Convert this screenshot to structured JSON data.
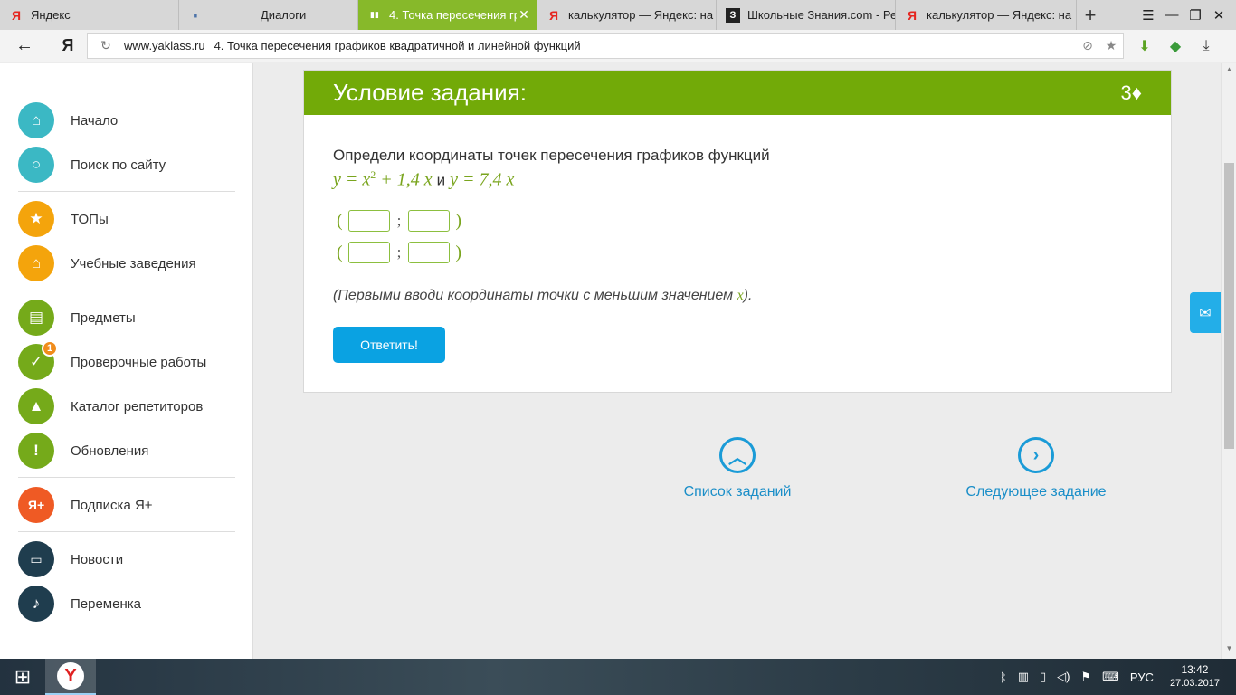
{
  "tabs": [
    {
      "icon": "Я",
      "icon_color": "#e52620",
      "title": "Яндекс",
      "active": false
    },
    {
      "icon": "▪",
      "icon_color": "#4b72a8",
      "title": "Диалоги",
      "active": false
    },
    {
      "icon": "▮▮",
      "icon_color": "#ffffff",
      "title": "4. Точка пересечения гр",
      "active": true
    },
    {
      "icon": "Я",
      "icon_color": "#e52620",
      "title": "калькулятор — Яндекс: на",
      "active": false
    },
    {
      "icon": "З",
      "icon_color": "#222222",
      "title": "Школьные Знания.com - Ре",
      "active": false
    },
    {
      "icon": "Я",
      "icon_color": "#e52620",
      "title": "калькулятор — Яндекс: на",
      "active": false
    }
  ],
  "address": {
    "domain": "www.yaklass.ru",
    "page_title": "4. Точка пересечения графиков квадратичной и линейной функций",
    "logo": "Я"
  },
  "sidebar": {
    "items": [
      {
        "label": "Начало",
        "icon": "home-icon",
        "glyph": "⌂",
        "color": "#3bb8c4"
      },
      {
        "label": "Поиск по сайту",
        "icon": "search-icon",
        "glyph": "○",
        "color": "#3bb8c4"
      },
      {
        "label": "ТОПы",
        "icon": "star-icon",
        "glyph": "★",
        "color": "#f4a40c"
      },
      {
        "label": "Учебные заведения",
        "icon": "institution-icon",
        "glyph": "⌂",
        "color": "#f4a40c"
      },
      {
        "label": "Предметы",
        "icon": "book-icon",
        "glyph": "▤",
        "color": "#75aa1a"
      },
      {
        "label": "Проверочные работы",
        "icon": "check-icon",
        "glyph": "✓",
        "color": "#75aa1a",
        "badge": "1"
      },
      {
        "label": "Каталог репетиторов",
        "icon": "graduation-cap-icon",
        "glyph": "▲",
        "color": "#75aa1a"
      },
      {
        "label": "Обновления",
        "icon": "exclamation-icon",
        "glyph": "!",
        "color": "#75aa1a"
      },
      {
        "label": "Подписка Я+",
        "icon": "ya-plus-icon",
        "glyph": "Я+",
        "color": "#ef5a24"
      },
      {
        "label": "Новости",
        "icon": "chat-icon",
        "glyph": "▭",
        "color": "#1f3d4e"
      },
      {
        "label": "Переменка",
        "icon": "bell-icon",
        "glyph": "♪",
        "color": "#1f3d4e"
      }
    ]
  },
  "task": {
    "header_title": "Условие задания:",
    "points": "3♦",
    "question": "Определи координаты точек пересечения графиков функций",
    "formula_part1": "y = x",
    "formula_exp": "2",
    "formula_part2": "+ 1,4 x",
    "formula_conj": "и",
    "formula_part3": "y = 7,4 x",
    "open_paren": "(",
    "semicolon": ";",
    "close_paren": ")",
    "hint_before": "(Первыми вводи координаты точки с меньшим значением ",
    "hint_var": "x",
    "hint_after": ").",
    "submit": "Ответить!"
  },
  "nav": {
    "list_label": "Список заданий",
    "next_label": "Следующее задание"
  },
  "taskbar": {
    "lang": "РУС",
    "time": "13:42",
    "date": "27.03.2017"
  }
}
